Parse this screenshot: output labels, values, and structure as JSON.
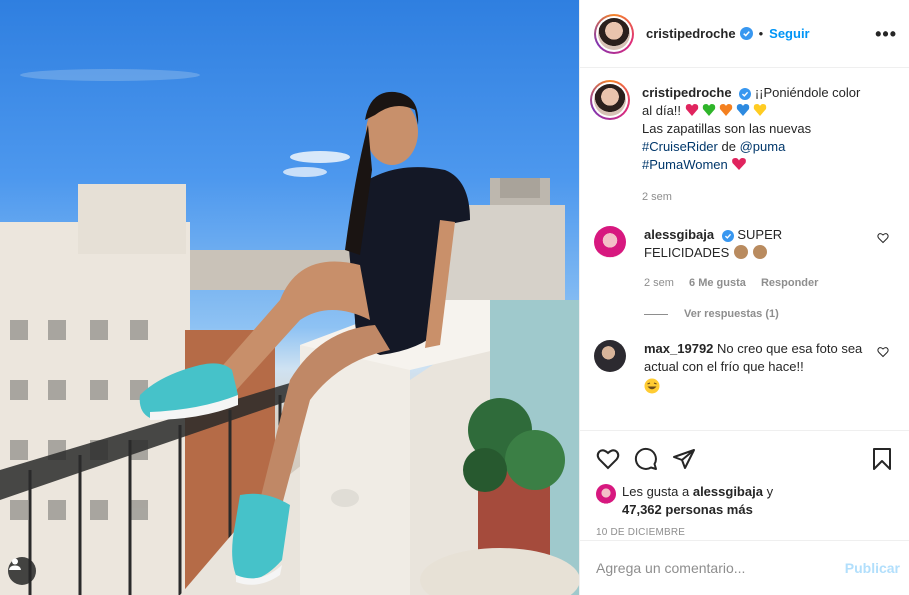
{
  "post": {
    "author": "cristipedroche",
    "follow_label": "Seguir",
    "dot": "•",
    "more_label": "•••"
  },
  "caption": {
    "username": "cristipedroche",
    "text_1": "¡¡Poniéndole color al día!!",
    "text_2": "Las zapatillas son las nuevas",
    "hashtag_1": "#CruiseRider",
    "de": "de",
    "mention": "@puma",
    "hashtag_2": "#PumaWomen",
    "time": "2 sem"
  },
  "comments": [
    {
      "username": "alessgibaja",
      "text": "SUPER FELICIDADES",
      "time": "2 sem",
      "likes": "6 Me gusta",
      "reply": "Responder",
      "view_replies": "Ver respuestas (1)"
    },
    {
      "username": "max_19792",
      "text": "No creo que esa foto sea actual con el frío que hace!!"
    }
  ],
  "likes_section": {
    "prefix": "Les gusta a",
    "user": "alessgibaja",
    "and": "y",
    "others": "47,362 personas más",
    "date": "10 DE DICIEMBRE"
  },
  "add_comment": {
    "placeholder": "Agrega un comentario...",
    "publish_label": "Publicar"
  },
  "colors": {
    "accent": "#0095f6",
    "verified": "#3897f0",
    "border": "#efefef",
    "muted": "#8e8e8e"
  },
  "icons": [
    "user-tag-icon",
    "verified-icon",
    "more-icon",
    "heart-icon",
    "comment-icon",
    "share-icon",
    "save-icon"
  ]
}
